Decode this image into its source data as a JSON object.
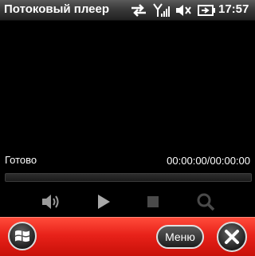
{
  "titlebar": {
    "app_title": "Потоковый плеер",
    "clock": "17:57",
    "icons": [
      "sync-arrows-icon",
      "signal-strength-icon",
      "volume-muted-icon",
      "battery-charging-icon"
    ]
  },
  "player": {
    "status": "Готово",
    "time": "00:00:00/00:00:00",
    "progress": 0,
    "controls": [
      "volume-icon",
      "play-icon",
      "stop-icon",
      "search-icon"
    ]
  },
  "softbar": {
    "menu_label": "Меню",
    "start_icon": "windows-flag-icon",
    "close_icon": "close-icon"
  },
  "colors": {
    "softbar": "#e8221a",
    "background": "#000000",
    "controls": "#9a9a9a"
  }
}
